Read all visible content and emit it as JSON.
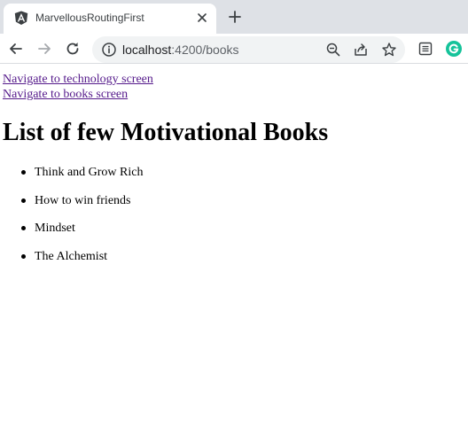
{
  "browser": {
    "tab": {
      "title": "MarvellousRoutingFirst",
      "favicon": "angular-icon"
    },
    "address_bar": {
      "host": "localhost",
      "port_path": ":4200/books"
    },
    "icons": {
      "back": "back-arrow-icon",
      "forward": "forward-arrow-icon",
      "reload": "reload-icon",
      "site_info": "info-icon",
      "zoom": "zoom-out-icon",
      "share": "share-icon",
      "bookmark": "star-icon",
      "reading_list": "reading-list-icon",
      "extension": "grammarly-icon"
    },
    "colors": {
      "tab_strip": "#dee1e6",
      "omnibox": "#f1f3f4",
      "grammarly": "#15c39a",
      "visited_link": "#551a8b"
    }
  },
  "page": {
    "links": [
      {
        "label": "Navigate to technology screen"
      },
      {
        "label": "Navigate to books screen"
      }
    ],
    "heading": "List of few Motivational Books",
    "books": [
      "Think and Grow Rich",
      "How to win friends",
      "Mindset",
      "The Alchemist"
    ]
  }
}
